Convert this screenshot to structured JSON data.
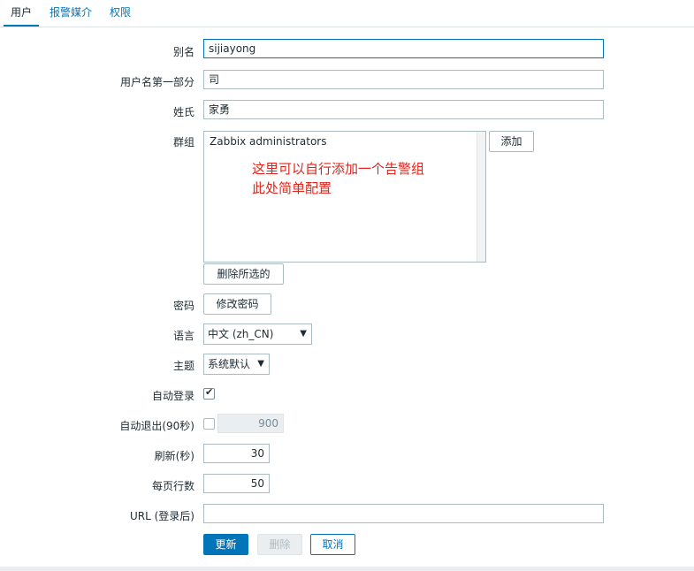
{
  "tabs": [
    {
      "label": "用户",
      "active": true
    },
    {
      "label": "报警媒介",
      "active": false
    },
    {
      "label": "权限",
      "active": false
    }
  ],
  "form": {
    "alias": {
      "label": "别名",
      "value": "sijiayong"
    },
    "name": {
      "label": "用户名第一部分",
      "value": "司"
    },
    "surname": {
      "label": "姓氏",
      "value": "家勇"
    },
    "groups": {
      "label": "群组",
      "items": [
        "Zabbix administrators"
      ],
      "add_button": "添加",
      "remove_button": "删除所选的"
    },
    "annotation": {
      "line1": "这里可以自行添加一个告警组",
      "line2": "此处简单配置"
    },
    "password": {
      "label": "密码",
      "button": "修改密码"
    },
    "language": {
      "label": "语言",
      "selected": "中文 (zh_CN)"
    },
    "theme": {
      "label": "主题",
      "selected": "系统默认"
    },
    "autologin": {
      "label": "自动登录",
      "checked": true
    },
    "autologout": {
      "label": "自动退出(90秒)",
      "checked": false,
      "value": "900"
    },
    "refresh": {
      "label": "刷新(秒)",
      "value": "30"
    },
    "rows_per_page": {
      "label": "每页行数",
      "value": "50"
    },
    "url": {
      "label": "URL (登录后)",
      "value": ""
    }
  },
  "actions": {
    "update": "更新",
    "delete": "删除",
    "cancel": "取消"
  },
  "colors": {
    "accent": "#0275b8",
    "annotation": "#e2231a"
  },
  "icons": {
    "dropdown": "chevron-down-icon",
    "check": "checkmark-icon"
  }
}
